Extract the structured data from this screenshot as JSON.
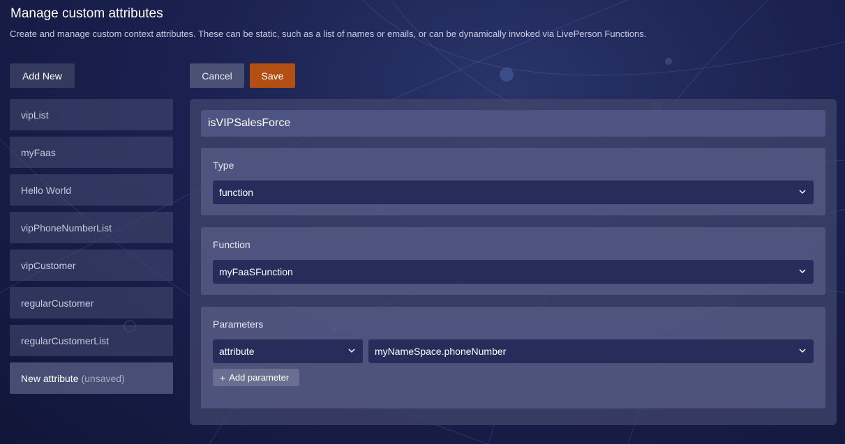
{
  "page": {
    "title": "Manage custom attributes",
    "subtitle": "Create and manage custom context attributes. These can be static, such as a list of names or emails, or can be dynamically invoked via LivePerson Functions."
  },
  "toolbar": {
    "add_new_label": "Add New",
    "cancel_label": "Cancel",
    "save_label": "Save"
  },
  "sidebar": {
    "items": [
      {
        "label": "vipList"
      },
      {
        "label": "myFaas"
      },
      {
        "label": "Hello World"
      },
      {
        "label": "vipPhoneNumberList"
      },
      {
        "label": "vipCustomer"
      },
      {
        "label": "regularCustomer"
      },
      {
        "label": "regularCustomerList"
      }
    ],
    "active_item": {
      "label": "New attribute",
      "status": "(unsaved)"
    }
  },
  "editor": {
    "name": "isVIPSalesForce",
    "type": {
      "label": "Type",
      "value": "function"
    },
    "function": {
      "label": "Function",
      "value": "myFaaSFunction"
    },
    "parameters": {
      "label": "Parameters",
      "items": [
        {
          "source": "attribute",
          "value": "myNameSpace.phoneNumber"
        }
      ],
      "add_label": "Add parameter"
    }
  },
  "colors": {
    "save_button": "#b44f14",
    "background": "#1a2150"
  },
  "icons": {
    "select_chevron": "chevron-down-icon",
    "add": "plus-icon"
  }
}
